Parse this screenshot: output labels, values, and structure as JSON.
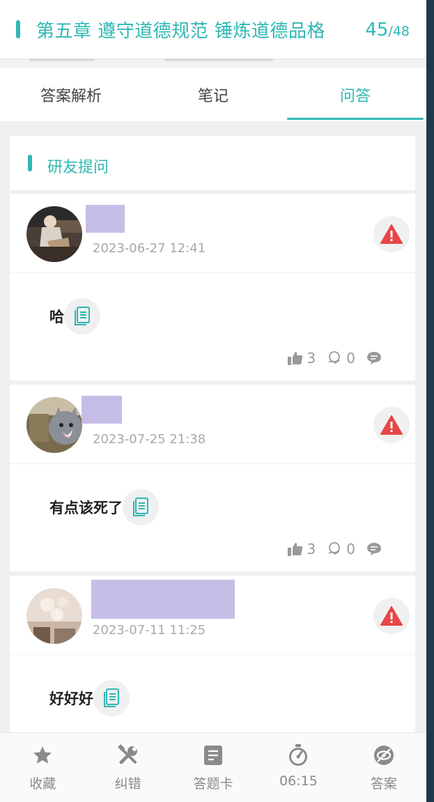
{
  "header": {
    "title": "第五章 遵守道德规范 锤炼道德品格",
    "current": "45",
    "total": "/48"
  },
  "tabs": [
    {
      "label": "答案解析",
      "active": false
    },
    {
      "label": "笔记",
      "active": false
    },
    {
      "label": "问答",
      "active": true
    }
  ],
  "section": {
    "title": "研友提问"
  },
  "questions": [
    {
      "timestamp": "2023-06-27 12:41",
      "text": "哈",
      "likes": "3",
      "replies": "0"
    },
    {
      "timestamp": "2023-07-25 21:38",
      "text": "有点该死了",
      "likes": "3",
      "replies": "0"
    },
    {
      "timestamp": "2023-07-11 11:25",
      "text": "好好好",
      "likes": "",
      "replies": ""
    }
  ],
  "bottom_nav": [
    {
      "label": "收藏",
      "icon": "star-icon"
    },
    {
      "label": "纠错",
      "icon": "tools-icon"
    },
    {
      "label": "答题卡",
      "icon": "answer-sheet-icon"
    },
    {
      "label": "06:15",
      "icon": "stopwatch-icon"
    },
    {
      "label": "答案",
      "icon": "eye-off-icon"
    }
  ],
  "colors": {
    "accent": "#2fb7b4",
    "report": "#e84646",
    "mask": "#c6bde6"
  }
}
